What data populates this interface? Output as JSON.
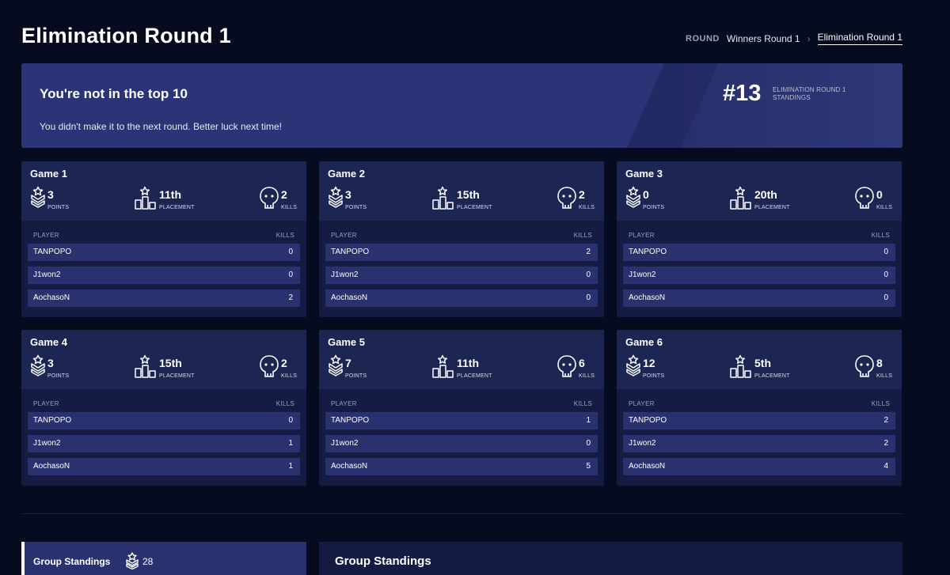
{
  "page": {
    "title": "Elimination Round 1"
  },
  "breadcrumb": {
    "label": "ROUND",
    "items": [
      "Winners Round 1",
      "Elimination Round 1"
    ]
  },
  "banner": {
    "title": "You're not in the top 10",
    "subtitle": "You didn't make it to the next round. Better luck next time!",
    "rank": "#13",
    "rank_label": "ELIMINATION ROUND 1 STANDINGS"
  },
  "labels": {
    "points": "POINTS",
    "placement": "PLACEMENT",
    "kills": "KILLS",
    "player": "PLAYER",
    "kills_col": "KILLS"
  },
  "games": [
    {
      "title": "Game 1",
      "points": "3",
      "placement": "11th",
      "kills": "2",
      "players": [
        {
          "name": "TANPOPO",
          "kills": "0"
        },
        {
          "name": "J1won2",
          "kills": "0"
        },
        {
          "name": "AochasoN",
          "kills": "2"
        }
      ]
    },
    {
      "title": "Game 2",
      "points": "3",
      "placement": "15th",
      "kills": "2",
      "players": [
        {
          "name": "TANPOPO",
          "kills": "2"
        },
        {
          "name": "J1won2",
          "kills": "0"
        },
        {
          "name": "AochasoN",
          "kills": "0"
        }
      ]
    },
    {
      "title": "Game 3",
      "points": "0",
      "placement": "20th",
      "kills": "0",
      "players": [
        {
          "name": "TANPOPO",
          "kills": "0"
        },
        {
          "name": "J1won2",
          "kills": "0"
        },
        {
          "name": "AochasoN",
          "kills": "0"
        }
      ]
    },
    {
      "title": "Game 4",
      "points": "3",
      "placement": "15th",
      "kills": "2",
      "players": [
        {
          "name": "TANPOPO",
          "kills": "0"
        },
        {
          "name": "J1won2",
          "kills": "1"
        },
        {
          "name": "AochasoN",
          "kills": "1"
        }
      ]
    },
    {
      "title": "Game 5",
      "points": "7",
      "placement": "11th",
      "kills": "6",
      "players": [
        {
          "name": "TANPOPO",
          "kills": "1"
        },
        {
          "name": "J1won2",
          "kills": "0"
        },
        {
          "name": "AochasoN",
          "kills": "5"
        }
      ]
    },
    {
      "title": "Game 6",
      "points": "12",
      "placement": "5th",
      "kills": "8",
      "players": [
        {
          "name": "TANPOPO",
          "kills": "2"
        },
        {
          "name": "J1won2",
          "kills": "2"
        },
        {
          "name": "AochasoN",
          "kills": "4"
        }
      ]
    }
  ],
  "group_standings": {
    "tab_label": "Group Standings",
    "points": "28",
    "panel_title": "Group Standings"
  },
  "icons": [
    "chevron-right-icon",
    "points-chevron-icon",
    "podium-star-icon",
    "skull-icon"
  ],
  "colors": {
    "background": "#060b1f",
    "banner": "#2b3476",
    "card": "#151b42",
    "card_header": "#1d2553",
    "row": "#29326e"
  }
}
